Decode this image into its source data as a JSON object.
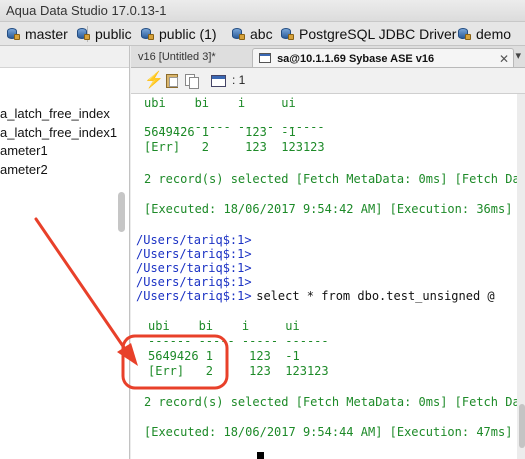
{
  "window": {
    "title": "Aqua Data Studio 17.0.13-1"
  },
  "server_tabs": [
    {
      "label": "master"
    },
    {
      "label": "public"
    },
    {
      "label": "public (1)"
    },
    {
      "label": "abc"
    },
    {
      "label": "PostgreSQL JDBC Driver II"
    },
    {
      "label": "demo"
    }
  ],
  "tree": {
    "items": [
      {
        "label": "a_latch_free_index"
      },
      {
        "label": "a_latch_free_index1"
      },
      {
        "label": "ameter1"
      },
      {
        "label": "ameter2"
      }
    ]
  },
  "editor_tabs": [
    {
      "label": "v16 [Untitled 3]*"
    },
    {
      "label": "sa@10.1.1.69 Sybase ASE v16"
    }
  ],
  "toolbar": {
    "counter": ": 1"
  },
  "output": {
    "lines": [
      {
        "text": "ubi    bi    i     ui",
        "color": "green"
      },
      {
        "text": "------ ----- ----- ------",
        "color": "green"
      },
      {
        "text": "5649426 1     123  -1",
        "color": "green"
      },
      {
        "text": "[Err]   2     123  123123",
        "color": "green"
      },
      {
        "text": "2 record(s) selected [Fetch MetaData: 0ms] [Fetch Dat",
        "color": "green"
      },
      {
        "text": "[Executed: 18/06/2017 9:54:42 AM] [Execution: 36ms]",
        "color": "green"
      },
      {
        "text": "/Users/tariq$:1>",
        "color": "blue"
      },
      {
        "text": "/Users/tariq$:1>",
        "color": "blue"
      },
      {
        "text": "/Users/tariq$:1>",
        "color": "blue"
      },
      {
        "text": "/Users/tariq$:1>",
        "color": "blue"
      },
      {
        "text": "/Users/tariq$:1>",
        "color": "blue"
      },
      {
        "text": " select * from dbo.test_unsigned @",
        "color": "black"
      },
      {
        "text": "ubi    bi    i     ui",
        "color": "green"
      },
      {
        "text": "------ ----- ----- ------",
        "color": "green"
      },
      {
        "text": "5649426 1     123  -1",
        "color": "green"
      },
      {
        "text": "[Err]   2     123  123123",
        "color": "green"
      },
      {
        "text": "2 record(s) selected [Fetch MetaData: 0ms] [Fetch Dat",
        "color": "green"
      },
      {
        "text": "[Executed: 18/06/2017 9:54:44 AM] [Execution: 47ms]",
        "color": "green"
      }
    ]
  },
  "annotation": {
    "color": "#e8402a"
  },
  "colors": {
    "accent": "#1b32c4",
    "result_green": "#1d8a28",
    "annotation_red": "#e8402a"
  }
}
